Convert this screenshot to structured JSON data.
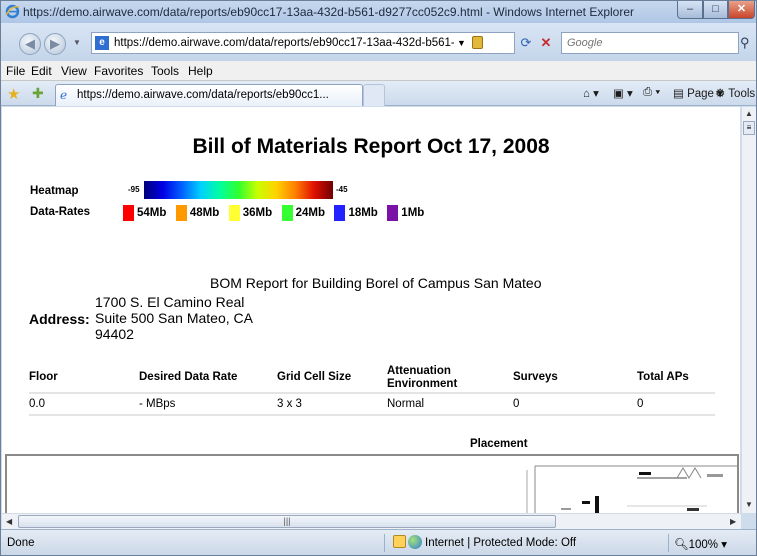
{
  "window": {
    "title": "https://demo.airwave.com/data/reports/eb90cc17-13aa-432d-b561-d9277cc052c9.html - Windows Internet Explorer",
    "minimize_glyph": "–",
    "maximize_glyph": "□",
    "close_glyph": "✕"
  },
  "address_bar": {
    "url": "https://demo.airwave.com/data/reports/eb90cc17-13aa-432d-b561-",
    "search_placeholder": "Google"
  },
  "menu": [
    "File",
    "Edit",
    "View",
    "Favorites",
    "Tools",
    "Help"
  ],
  "tab": {
    "label": "https://demo.airwave.com/data/reports/eb90cc1..."
  },
  "command_bar": {
    "page": "Page",
    "tools": "Tools"
  },
  "report": {
    "title": "Bill of Materials Report Oct 17, 2008",
    "heatmap_label": "Heatmap",
    "heatmap_min": "-95",
    "heatmap_max": "-45",
    "rates_label": "Data-Rates",
    "rates": [
      {
        "label": "54Mb",
        "color": "#ff0000"
      },
      {
        "label": "48Mb",
        "color": "#ff9900"
      },
      {
        "label": "36Mb",
        "color": "#ffff33"
      },
      {
        "label": "24Mb",
        "color": "#33ff33"
      },
      {
        "label": "18Mb",
        "color": "#2222ff"
      },
      {
        "label": "1Mb",
        "color": "#7a12a8"
      }
    ],
    "bom_heading": "BOM Report for Building Borel of Campus San Mateo",
    "address_label": "Address:",
    "address_lines": [
      "1700 S. El Camino Real",
      "Suite 500 San Mateo, CA",
      "94402"
    ],
    "table": {
      "headers": [
        "Floor",
        "Desired Data Rate",
        "Grid Cell Size",
        "Attenuation Environment",
        "Surveys",
        "Total APs"
      ],
      "rows": [
        [
          "0.0",
          "- MBps",
          "3 x 3",
          "Normal",
          "0",
          "0"
        ]
      ]
    },
    "placement_label": "Placement"
  },
  "status": {
    "text": "Done",
    "zone": "Internet | Protected Mode: Off",
    "zoom": "100%"
  }
}
